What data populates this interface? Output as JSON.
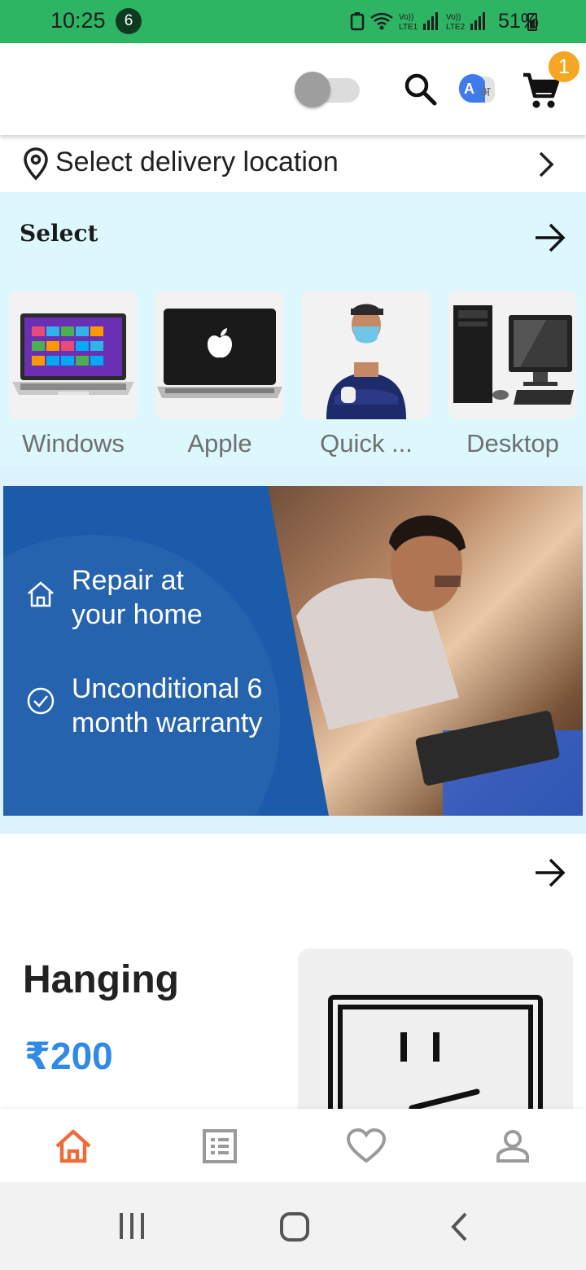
{
  "status_bar": {
    "time": "10:25",
    "notification_count": "6",
    "battery": "51%"
  },
  "header": {
    "toggle_on": false,
    "cart_count": "1",
    "icons": [
      "search-icon",
      "translate-icon",
      "cart-icon"
    ]
  },
  "location": {
    "label": "Select delivery location"
  },
  "categories": {
    "title": "Select",
    "items": [
      {
        "label": "Windows"
      },
      {
        "label": "Apple"
      },
      {
        "label": "Quick ..."
      },
      {
        "label": "Desktop"
      }
    ]
  },
  "banner": {
    "line1": "Repair at your home",
    "line2": "Unconditional 6 month warranty"
  },
  "product": {
    "name": "Hanging",
    "price": "₹200"
  },
  "bottom_nav": {
    "items": [
      "home-icon",
      "list-icon",
      "heart-icon",
      "profile-icon"
    ],
    "active": "home-icon",
    "active_color": "#ef6c3a"
  },
  "colors": {
    "status_bar": "#2db563",
    "category_bg": "#dcf8fc",
    "banner_blue": "#1b5baa",
    "price": "#2f8ae5",
    "badge": "#f5a623"
  }
}
